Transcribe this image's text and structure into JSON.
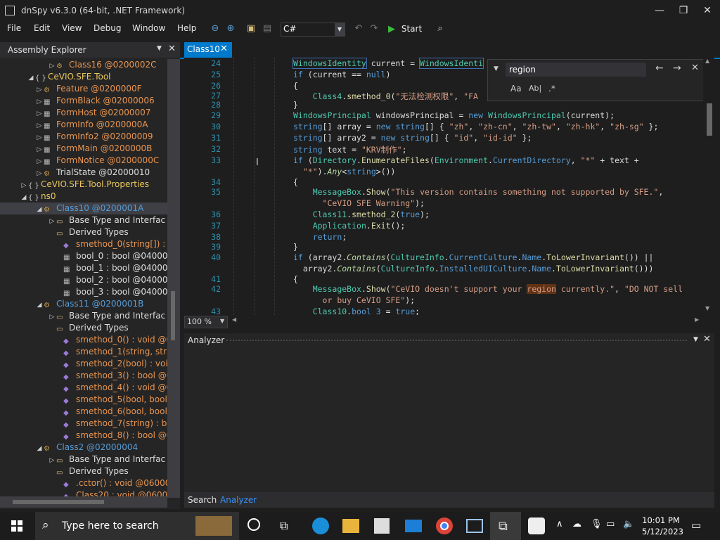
{
  "window": {
    "title": "dnSpy v6.3.0 (64-bit, .NET Framework)"
  },
  "menu": [
    "File",
    "Edit",
    "View",
    "Debug",
    "Window",
    "Help"
  ],
  "toolbar": {
    "language": "C#",
    "start_label": "Start"
  },
  "assembly_explorer": {
    "title": "Assembly Explorer",
    "rows": [
      {
        "t": "Class16 @0200002C"
      },
      {
        "t": "CeVIO.SFE.Tool"
      },
      {
        "t": "Feature @0200000F"
      },
      {
        "t": "FormBlack @02000006"
      },
      {
        "t": "FormHost @02000007"
      },
      {
        "t": "FormInfo @0200000A"
      },
      {
        "t": "FormInfo2 @02000009"
      },
      {
        "t": "FormMain @0200000B"
      },
      {
        "t": "FormNotice @0200000C"
      },
      {
        "t": "TrialState @02000010"
      },
      {
        "t": "CeVIO.SFE.Tool.Properties"
      },
      {
        "t": "ns0"
      },
      {
        "t": "Class10 @0200001A"
      },
      {
        "t": "Base Type and Interfac"
      },
      {
        "t": "Derived Types"
      },
      {
        "t": "smethod_0(string[]) : v"
      },
      {
        "t": "bool_0 : bool @040000"
      },
      {
        "t": "bool_1 : bool @040000"
      },
      {
        "t": "bool_2 : bool @040000"
      },
      {
        "t": "bool_3 : bool @040000"
      },
      {
        "t": "Class11 @0200001B"
      },
      {
        "t": "Base Type and Interfac"
      },
      {
        "t": "Derived Types"
      },
      {
        "t": "smethod_0() : void @0"
      },
      {
        "t": "smethod_1(string, strin"
      },
      {
        "t": "smethod_2(bool) : voi"
      },
      {
        "t": "smethod_3() : bool @0"
      },
      {
        "t": "smethod_4() : void @0"
      },
      {
        "t": "smethod_5(bool, bool"
      },
      {
        "t": "smethod_6(bool, bool"
      },
      {
        "t": "smethod_7(string) : bo"
      },
      {
        "t": "smethod_8() : bool @0"
      },
      {
        "t": "Class2 @02000004"
      },
      {
        "t": "Base Type and Interfac"
      },
      {
        "t": "Derived Types"
      },
      {
        "t": ".cctor() : void @06000"
      },
      {
        "t": "Class20 : void @06000"
      }
    ]
  },
  "editor": {
    "tab": "Class10",
    "line_numbers": [
      "24",
      "25",
      "26",
      "27",
      "28",
      "29",
      "30",
      "31",
      "32",
      "33",
      "",
      "34",
      "35",
      "",
      "36",
      "37",
      "38",
      "39",
      "40",
      "",
      "41",
      "42",
      "",
      "43"
    ],
    "zoom": "100 %",
    "find_query": "region",
    "find_opts": [
      "Aa",
      "Ab|",
      ".*"
    ]
  },
  "analyzer": {
    "title": "Analyzer"
  },
  "bottom_tabs": [
    "Search",
    "Analyzer"
  ],
  "taskbar": {
    "search_placeholder": "Type here to search",
    "time": "10:01 PM",
    "date": "5/12/2023"
  }
}
